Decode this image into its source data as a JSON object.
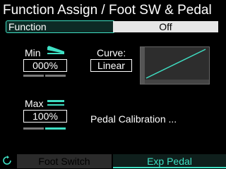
{
  "header": {
    "title": "Function Assign / Foot SW & Pedal"
  },
  "function_row": {
    "label": "Function",
    "value": "Off"
  },
  "min": {
    "label": "Min",
    "value": "000%",
    "level": 0
  },
  "max": {
    "label": "Max",
    "value": "100%",
    "level": 1
  },
  "curve": {
    "label": "Curve:",
    "value": "Linear"
  },
  "calibration": {
    "label": "Pedal Calibration ..."
  },
  "tabs": [
    {
      "label": "Foot Switch",
      "selected": false
    },
    {
      "label": "Exp Pedal",
      "selected": true
    }
  ],
  "colors": {
    "accent": "#3fe0c4",
    "background": "#000000",
    "value_bg": "#e6e6e6"
  },
  "icons": {
    "refresh": "refresh-icon",
    "pedal_min": "pedal-heel-icon",
    "pedal_max": "pedal-toe-icon"
  }
}
